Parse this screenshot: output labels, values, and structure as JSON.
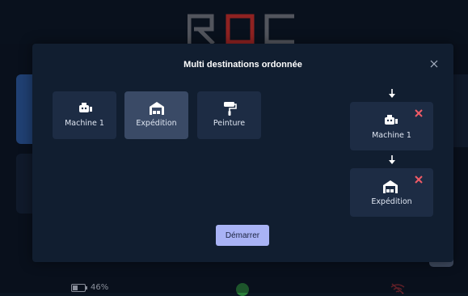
{
  "app": {
    "logo_text": "ROC"
  },
  "status_bar": {
    "battery_percent": 46,
    "battery_label": "46%"
  },
  "modal": {
    "title": "Multi destinations ordonnée",
    "options": [
      {
        "label": "Machine 1",
        "icon": "robot-icon",
        "selected": false
      },
      {
        "label": "Expédition",
        "icon": "warehouse-icon",
        "selected": true
      },
      {
        "label": "Peinture",
        "icon": "paint-roller-icon",
        "selected": false
      }
    ],
    "queue": [
      {
        "label": "Machine 1",
        "icon": "robot-icon"
      },
      {
        "label": "Expédition",
        "icon": "warehouse-icon"
      }
    ],
    "start_label": "Démarrer"
  },
  "colors": {
    "modal_bg": "#111e30",
    "card_bg": "#1d2c44",
    "card_selected": "#3a4a66",
    "accent_button": "#a9b3f5",
    "remove_red": "#ef5b66",
    "logo_red": "#d9302a",
    "logo_gray": "#7c7f86"
  }
}
